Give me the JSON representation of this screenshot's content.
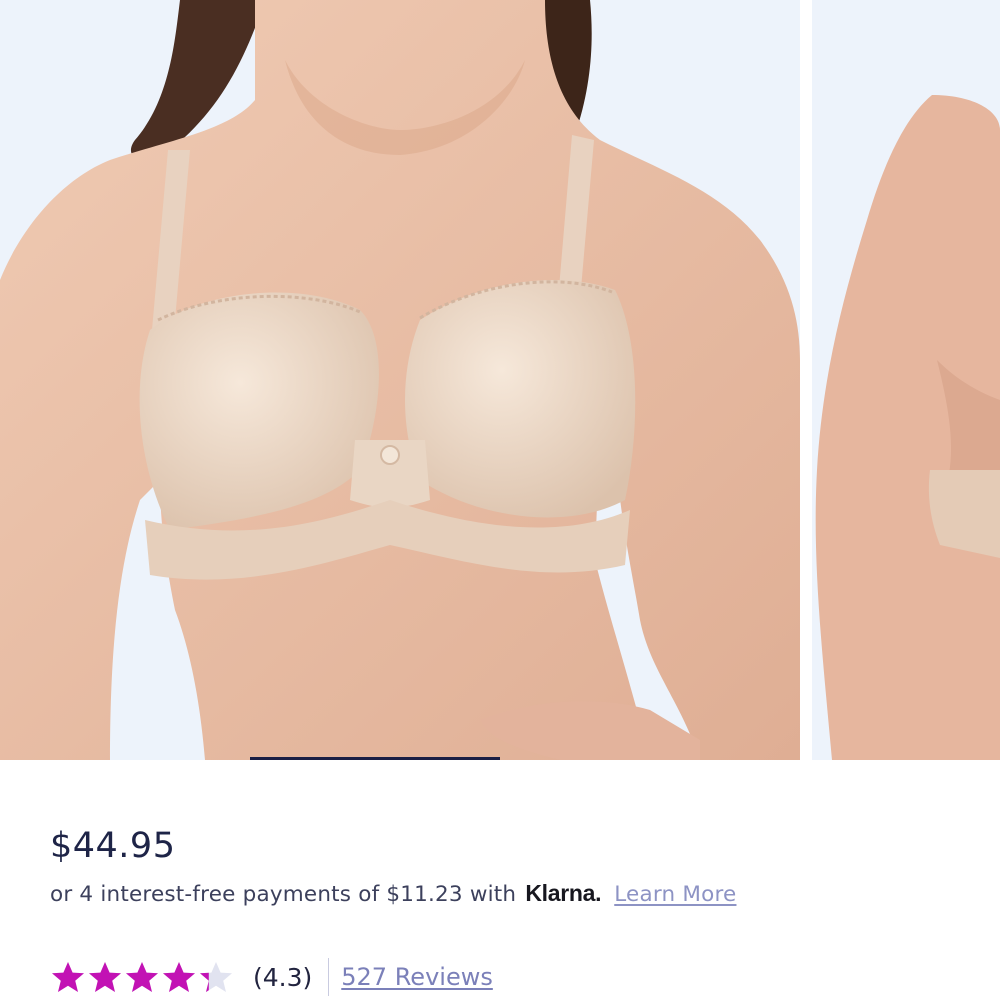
{
  "product": {
    "image_alt": "Model wearing a nude underwire t-shirt bra",
    "carousel": {
      "slide_count": 4,
      "active_index": 1
    },
    "price": "$44.95",
    "installments": {
      "text": "or 4 interest-free payments of $11.23 with",
      "provider": "Klarna.",
      "learn_more": "Learn More"
    },
    "rating": {
      "score": 4.3,
      "score_label": "(4.3)",
      "max": 5,
      "reviews_label": "527 Reviews"
    }
  },
  "colors": {
    "star_filled": "#c212b4",
    "star_empty": "#e1e3f0",
    "price_text": "#1e2447",
    "link": "#8d93c4",
    "photo_background": "#edf3fb",
    "active_indicator": "#1a1f45"
  },
  "icons": {
    "star": "star-icon",
    "klarna": "klarna-logo"
  }
}
